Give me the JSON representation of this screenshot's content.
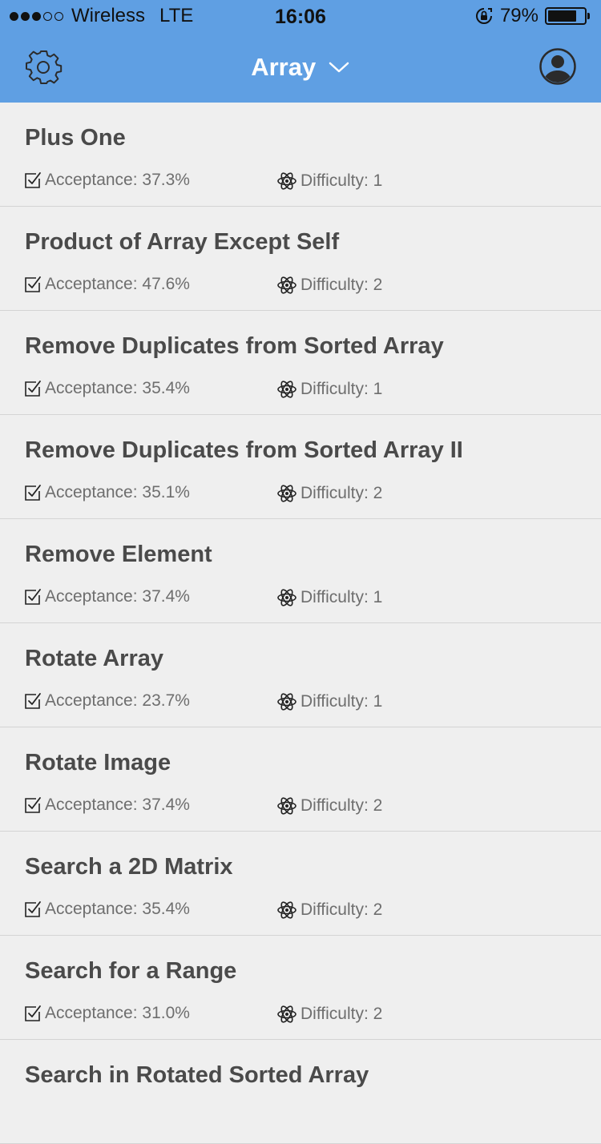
{
  "status_bar": {
    "signal_dots": [
      true,
      true,
      true,
      false,
      false
    ],
    "carrier": "Wireless",
    "network": "LTE",
    "time": "16:06",
    "battery_percent": "79%",
    "battery_level": 0.79
  },
  "nav": {
    "title": "Array",
    "settings_icon": "gear-icon",
    "profile_icon": "user-avatar-icon",
    "dropdown_icon": "chevron-down-icon"
  },
  "labels": {
    "acceptance": "Acceptance:",
    "difficulty": "Difficulty:"
  },
  "problems": [
    {
      "title": "Plus One",
      "acceptance": "37.3%",
      "difficulty": "1"
    },
    {
      "title": "Product of Array Except Self",
      "acceptance": "47.6%",
      "difficulty": "2"
    },
    {
      "title": "Remove Duplicates from Sorted Array",
      "acceptance": "35.4%",
      "difficulty": "1"
    },
    {
      "title": "Remove Duplicates from Sorted Array II",
      "acceptance": "35.1%",
      "difficulty": "2"
    },
    {
      "title": "Remove Element",
      "acceptance": "37.4%",
      "difficulty": "1"
    },
    {
      "title": "Rotate Array",
      "acceptance": "23.7%",
      "difficulty": "1"
    },
    {
      "title": "Rotate Image",
      "acceptance": "37.4%",
      "difficulty": "2"
    },
    {
      "title": "Search a 2D Matrix",
      "acceptance": "35.4%",
      "difficulty": "2"
    },
    {
      "title": "Search for a Range",
      "acceptance": "31.0%",
      "difficulty": "2"
    },
    {
      "title": "Search in Rotated Sorted Array",
      "acceptance": "",
      "difficulty": ""
    }
  ],
  "colors": {
    "header_bg": "#5f9fe3",
    "list_bg": "#efefef",
    "title_text": "#4a4a4a",
    "meta_text": "#6e6e6e",
    "divider": "#d4d4d4"
  }
}
